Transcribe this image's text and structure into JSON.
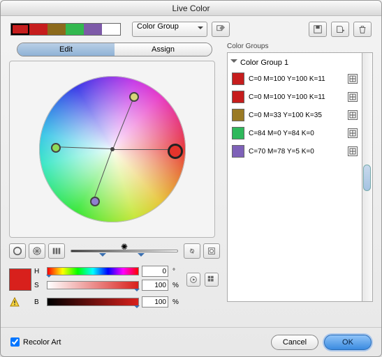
{
  "title": "Live Color",
  "swatches": [
    "#c61d1d",
    "#c61d1d",
    "#8c6a1c",
    "#33b84f",
    "#7d5aa8",
    "#ffffff"
  ],
  "colorGroupField": "Color Group",
  "tabs": {
    "edit": "Edit",
    "assign": "Assign"
  },
  "hsb": {
    "h_label": "H",
    "s_label": "S",
    "b_label": "B",
    "h": "0",
    "s": "100",
    "b": "100",
    "pct": "%",
    "deg": "°"
  },
  "colorGroups": {
    "label": "Color Groups",
    "group_name": "Color Group 1",
    "items": [
      {
        "sw": "#c61d1d",
        "name": "C=0 M=100 Y=100 K=11"
      },
      {
        "sw": "#c61d1d",
        "name": "C=0 M=100 Y=100 K=11"
      },
      {
        "sw": "#9a7a24",
        "name": "C=0 M=33 Y=100 K=35"
      },
      {
        "sw": "#2fb85b",
        "name": "C=84 M=0 Y=84 K=0"
      },
      {
        "sw": "#7e61b8",
        "name": "C=70 M=78 Y=5 K=0"
      }
    ]
  },
  "footer": {
    "recolor": "Recolor Art",
    "recolor_checked": true,
    "cancel": "Cancel",
    "ok": "OK"
  },
  "active_swatch": "#d8201c"
}
